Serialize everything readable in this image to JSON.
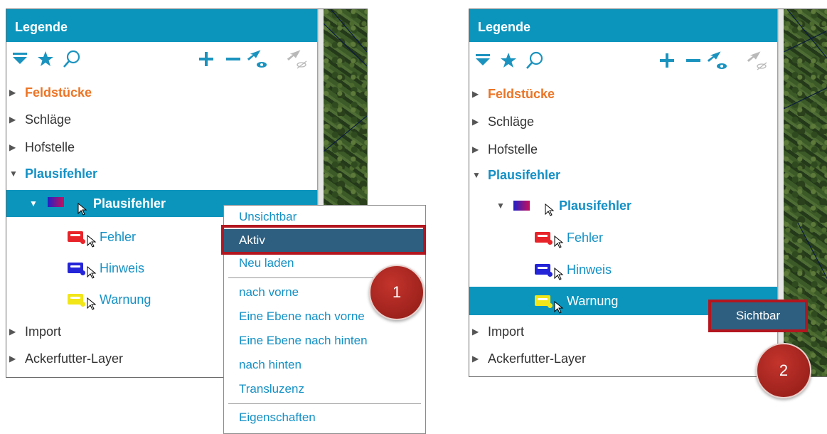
{
  "left_panel": {
    "header_title": "Legende",
    "tree": {
      "feldstuecke": "Feldstücke",
      "schlaege": "Schläge",
      "hofstelle": "Hofstelle",
      "plausifehler_group": "Plausifehler",
      "plausifehler_layer": "Plausifehler",
      "fehler": "Fehler",
      "hinweis": "Hinweis",
      "warnung": "Warnung",
      "import": "Import",
      "ackerfutter": "Ackerfutter-Layer"
    },
    "context_menu": {
      "items": [
        "Unsichtbar",
        "Aktiv",
        "Neu laden",
        "nach vorne",
        "Eine Ebene nach vorne",
        "Eine Ebene nach hinten",
        "nach hinten",
        "Transluzenz",
        "Eigenschaften"
      ],
      "highlighted_item": "Aktiv"
    },
    "step_badge": "1"
  },
  "right_panel": {
    "header_title": "Legende",
    "tree": {
      "feldstuecke": "Feldstücke",
      "schlaege": "Schläge",
      "hofstelle": "Hofstelle",
      "plausifehler_group": "Plausifehler",
      "plausifehler_layer": "Plausifehler",
      "fehler": "Fehler",
      "hinweis": "Hinweis",
      "warnung": "Warnung",
      "import": "Import",
      "ackerfutter": "Ackerfutter-Layer"
    },
    "tooltip": "Sichtbar",
    "step_badge": "2"
  },
  "icons": [
    "filter-icon",
    "star-icon",
    "search-icon",
    "plus-icon",
    "minus-icon",
    "visible-cursor-icon",
    "invisible-cursor-icon"
  ],
  "colors": {
    "header_bg": "#0b95bd",
    "link_blue": "#1390c5",
    "orange": "#ec7425",
    "menu_active": "#2e5f80",
    "highlight_red": "#b3161f",
    "fehler_symbol": "#e8242a",
    "hinweis_symbol": "#2424d8",
    "warnung_symbol": "#f2e618"
  }
}
